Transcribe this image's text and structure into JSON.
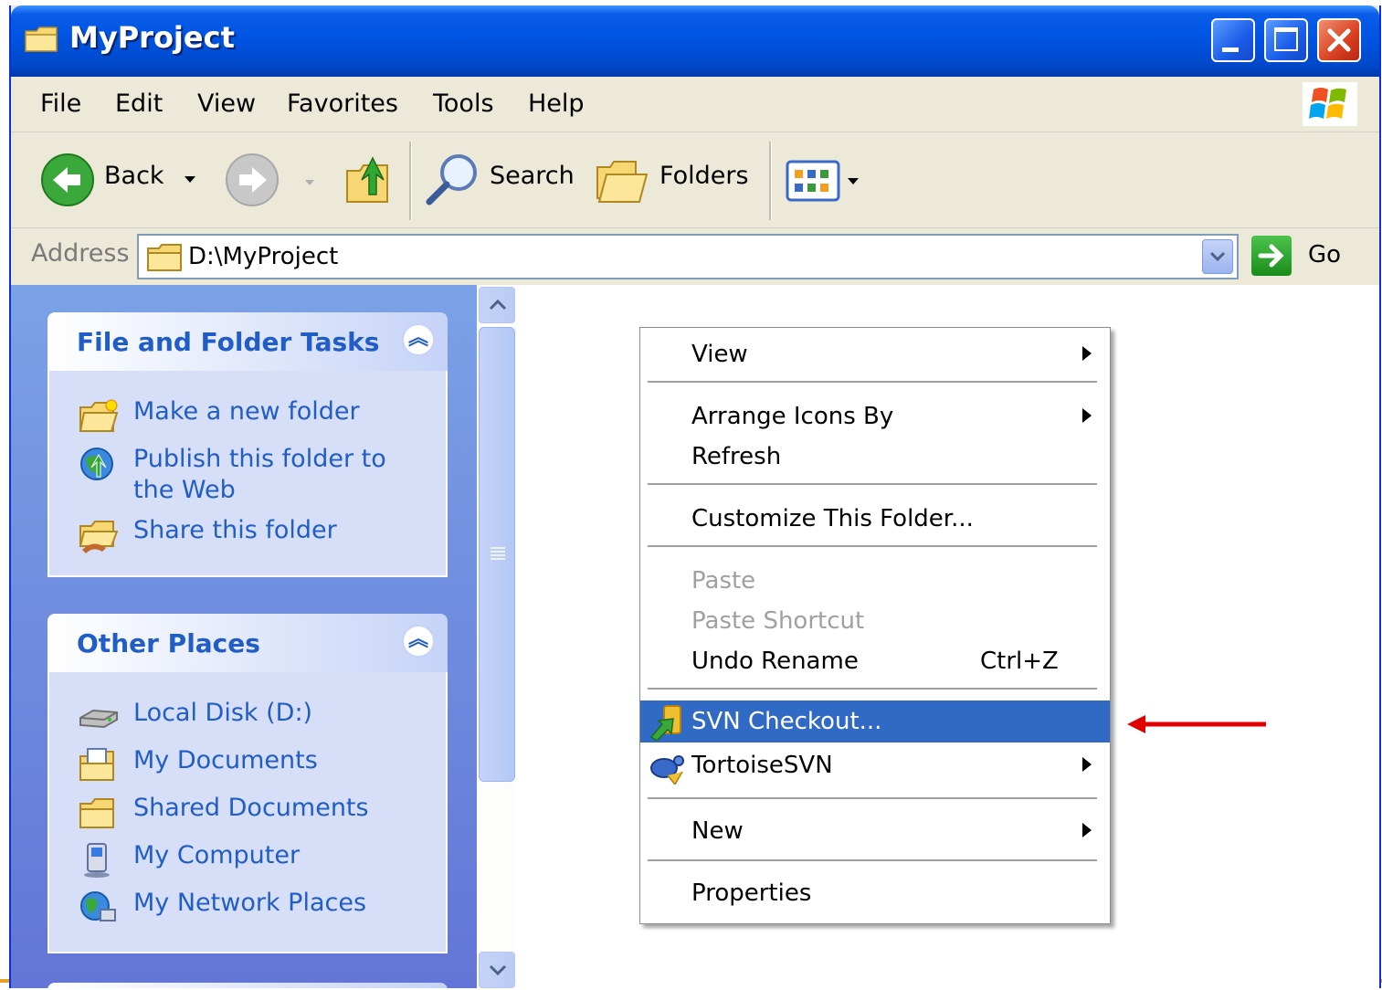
{
  "window": {
    "title": "MyProject"
  },
  "menubar": {
    "items": [
      "File",
      "Edit",
      "View",
      "Favorites",
      "Tools",
      "Help"
    ]
  },
  "toolbar": {
    "back_label": "Back",
    "search_label": "Search",
    "folders_label": "Folders"
  },
  "addressbar": {
    "label": "Address",
    "value": "D:\\MyProject",
    "go_label": "Go"
  },
  "file_tasks": {
    "title": "File and Folder Tasks",
    "items": [
      "Make a new folder",
      "Publish this folder to",
      "the Web",
      "Share this folder"
    ]
  },
  "other_places": {
    "title": "Other Places",
    "items": [
      "Local Disk (D:)",
      "My Documents",
      "Shared Documents",
      "My Computer",
      "My Network Places"
    ]
  },
  "context_menu": {
    "items": [
      {
        "label": "View",
        "submenu": true
      },
      {
        "label": "Arrange Icons By",
        "submenu": true
      },
      {
        "label": "Refresh"
      },
      {
        "label": "Customize This Folder..."
      },
      {
        "label": "Paste",
        "disabled": true
      },
      {
        "label": "Paste Shortcut",
        "disabled": true
      },
      {
        "label": "Undo Rename",
        "shortcut": "Ctrl+Z"
      },
      {
        "label": "SVN Checkout...",
        "highlighted": true
      },
      {
        "label": "TortoiseSVN",
        "submenu": true
      },
      {
        "label": "New",
        "submenu": true
      },
      {
        "label": "Properties"
      }
    ]
  },
  "colors": {
    "titlebar": "#0054e3",
    "taskpane": "#6375d6",
    "panel_link": "#215dc6",
    "menu_highlight": "#316ac5",
    "annotation_arrow": "#e00000"
  }
}
